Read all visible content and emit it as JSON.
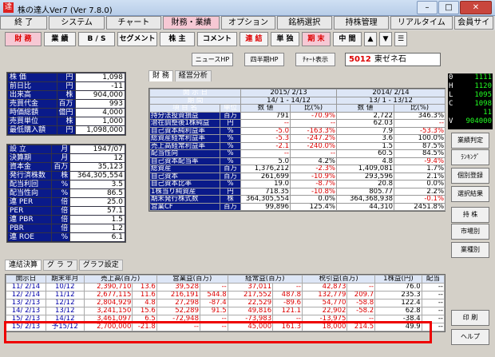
{
  "window": {
    "title": "株の達人Ver7 (Ver 7.8.0)",
    "icon_char": "達"
  },
  "menu": [
    "終 了",
    "システム",
    "チャート",
    "財務・業績",
    "オプション",
    "銘柄選択",
    "持株管理",
    "リアルタイム",
    "会員サイト"
  ],
  "toolbar": [
    "財 務",
    "業 績",
    "B / S",
    "セグメント",
    "株 主",
    "コメント",
    "連 結",
    "単 独",
    "期 末",
    "中 間",
    "▲",
    "▼",
    "☰"
  ],
  "toolbar2": [
    "ニュースHP",
    "四半期HP",
    "ﾁｬｰﾄ表示"
  ],
  "stock": {
    "code": "5012",
    "name": "東ゼネ石"
  },
  "ticker": [
    {
      "k": "0",
      "v": "1111"
    },
    {
      "k": "H",
      "v": "1120"
    },
    {
      "k": "L",
      "v": "1095"
    },
    {
      "k": "C",
      "v": "1098"
    },
    {
      "k": "",
      "v": "11"
    },
    {
      "k": "V",
      "v": "904000"
    }
  ],
  "side_buttons": [
    "業績判定",
    "ﾗﾝｷﾝｸﾞ",
    "個別登録",
    "選択結果",
    "持 株",
    "市場別",
    "業種別",
    "印 刷",
    "ヘルプ"
  ],
  "left_top": [
    {
      "label": "株 価",
      "unit": "円",
      "value": "1,098"
    },
    {
      "label": "前日比",
      "unit": "円",
      "value": "-11"
    },
    {
      "label": "出来高",
      "unit": "株",
      "value": "904,000"
    },
    {
      "label": "売買代金",
      "unit": "百万",
      "value": "993"
    },
    {
      "label": "時価総額",
      "unit": "億円",
      "value": "4,000"
    },
    {
      "label": "売買単位",
      "unit": "株",
      "value": "1,000"
    },
    {
      "label": "最低購入額",
      "unit": "円",
      "value": "1,098,000"
    }
  ],
  "left_bottom": [
    {
      "label": "設 立",
      "unit": "月",
      "value": "1947/07"
    },
    {
      "label": "決算期",
      "unit": "月",
      "value": "12"
    },
    {
      "label": "資本金",
      "unit": "百万",
      "value": "35,123"
    },
    {
      "label": "発行済株数",
      "unit": "株",
      "value": "364,305,554"
    },
    {
      "label": "配当利回",
      "unit": "%",
      "value": "3.5"
    },
    {
      "label": "配当性向",
      "unit": "%",
      "value": "86.5"
    },
    {
      "label": "連 PER",
      "unit": "倍",
      "value": "25.0"
    },
    {
      "label": "PER",
      "unit": "倍",
      "value": "57.1"
    },
    {
      "label": "連 PBR",
      "unit": "倍",
      "value": "1.5"
    },
    {
      "label": "PBR",
      "unit": "倍",
      "value": "1.2"
    },
    {
      "label": "連 ROE",
      "unit": "%",
      "value": "6.1"
    }
  ],
  "tabs": [
    "財 務",
    "経営分析"
  ],
  "main_header": {
    "r1": [
      "開 示 日",
      "",
      "2015/ 2/13",
      "2014/ 2/14"
    ],
    "r2": [
      "期 間",
      "",
      "14/ 1 - 14/12",
      "13/ 1 - 13/12"
    ],
    "r3": [
      "項 目 名",
      "単位",
      "数 値",
      "比(%)",
      "数 値",
      "比(%)"
    ]
  },
  "main_rows": [
    [
      "持分法投資損益",
      "百万",
      "791",
      "-70.9%",
      "2,722",
      "346.3%"
    ],
    [
      "潜在調整後1株純益",
      "円",
      "--",
      "--",
      "62.03",
      "--"
    ],
    [
      "自己資本純利益率",
      "%",
      "-5.0",
      "-163.3%",
      "7.9",
      "-53.3%"
    ],
    [
      "総資産経常利益率",
      "%",
      "-5.3",
      "-247.2%",
      "3.6",
      "100.0%"
    ],
    [
      "売上高経常利益率",
      "%",
      "-2.1",
      "-240.0%",
      "1.5",
      "87.5%"
    ],
    [
      "配当性向",
      "%",
      "--",
      "--",
      "60.5",
      "84.5%"
    ],
    [
      "自己資本配当率",
      "%",
      "5.0",
      "4.2%",
      "4.8",
      "-9.4%"
    ],
    [
      "総資産",
      "百万",
      "1,376,212",
      "-2.3%",
      "1,409,081",
      "1.7%"
    ],
    [
      "自己資本",
      "百万",
      "261,699",
      "-10.9%",
      "293,596",
      "2.1%"
    ],
    [
      "自己資本比率",
      "%",
      "19.0",
      "-8.7%",
      "20.8",
      "0.0%"
    ],
    [
      "1株当り純資産",
      "円",
      "718.35",
      "-10.8%",
      "805.77",
      "2.2%"
    ],
    [
      "期末発行株式数",
      "株",
      "364,305,554",
      "0.0%",
      "364,368,938",
      "-0.1%"
    ],
    [
      "営業CF",
      "百万",
      "99,896",
      "125.4%",
      "44,310",
      "2451.8%"
    ]
  ],
  "bottom_tabs": [
    "連結決算",
    "グ ラ フ",
    "グラフ設定"
  ],
  "bottom_header": [
    "開示日",
    "期末年月",
    "売上高(百万)",
    "",
    "営業益(百万)",
    "",
    "経常益(百万)",
    "",
    "税引益(百万)",
    "",
    "1株益(円)",
    "配当"
  ],
  "bottom_rows": [
    [
      "11/ 2/14",
      "10/12",
      "2,390,710",
      "13.6",
      "39,528",
      "--",
      "37,011",
      "--",
      "42,873",
      "--",
      "76.0",
      "--"
    ],
    [
      "12/ 2/14",
      "11/12",
      "2,677,115",
      "11.6",
      "216,191",
      "544.8",
      "217,552",
      "487.8",
      "132,779",
      "209.7",
      "235.3",
      "--"
    ],
    [
      "13/ 2/13",
      "12/12",
      "2,804,929",
      "4.8",
      "27,298",
      "-87.4",
      "22,529",
      "-89.6",
      "54,770",
      "-58.8",
      "122.4",
      "--"
    ],
    [
      "14/ 2/13",
      "13/12",
      "3,241,150",
      "15.6",
      "52,289",
      "91.5",
      "49,816",
      "121.1",
      "22,902",
      "-58.2",
      "62.8",
      "--"
    ],
    [
      "15/ 2/13",
      "14/12",
      "3,461,097",
      "6.5",
      "-72,948",
      "--",
      "-73,983",
      "--",
      "-13,975",
      "--",
      "-38.4",
      "--"
    ],
    [
      "15/ 2/13",
      "予15/12",
      "2,700,000",
      "-21.8",
      "--",
      "--",
      "45,000",
      "161.3",
      "18,000",
      "214.5",
      "49.9",
      "--"
    ]
  ]
}
